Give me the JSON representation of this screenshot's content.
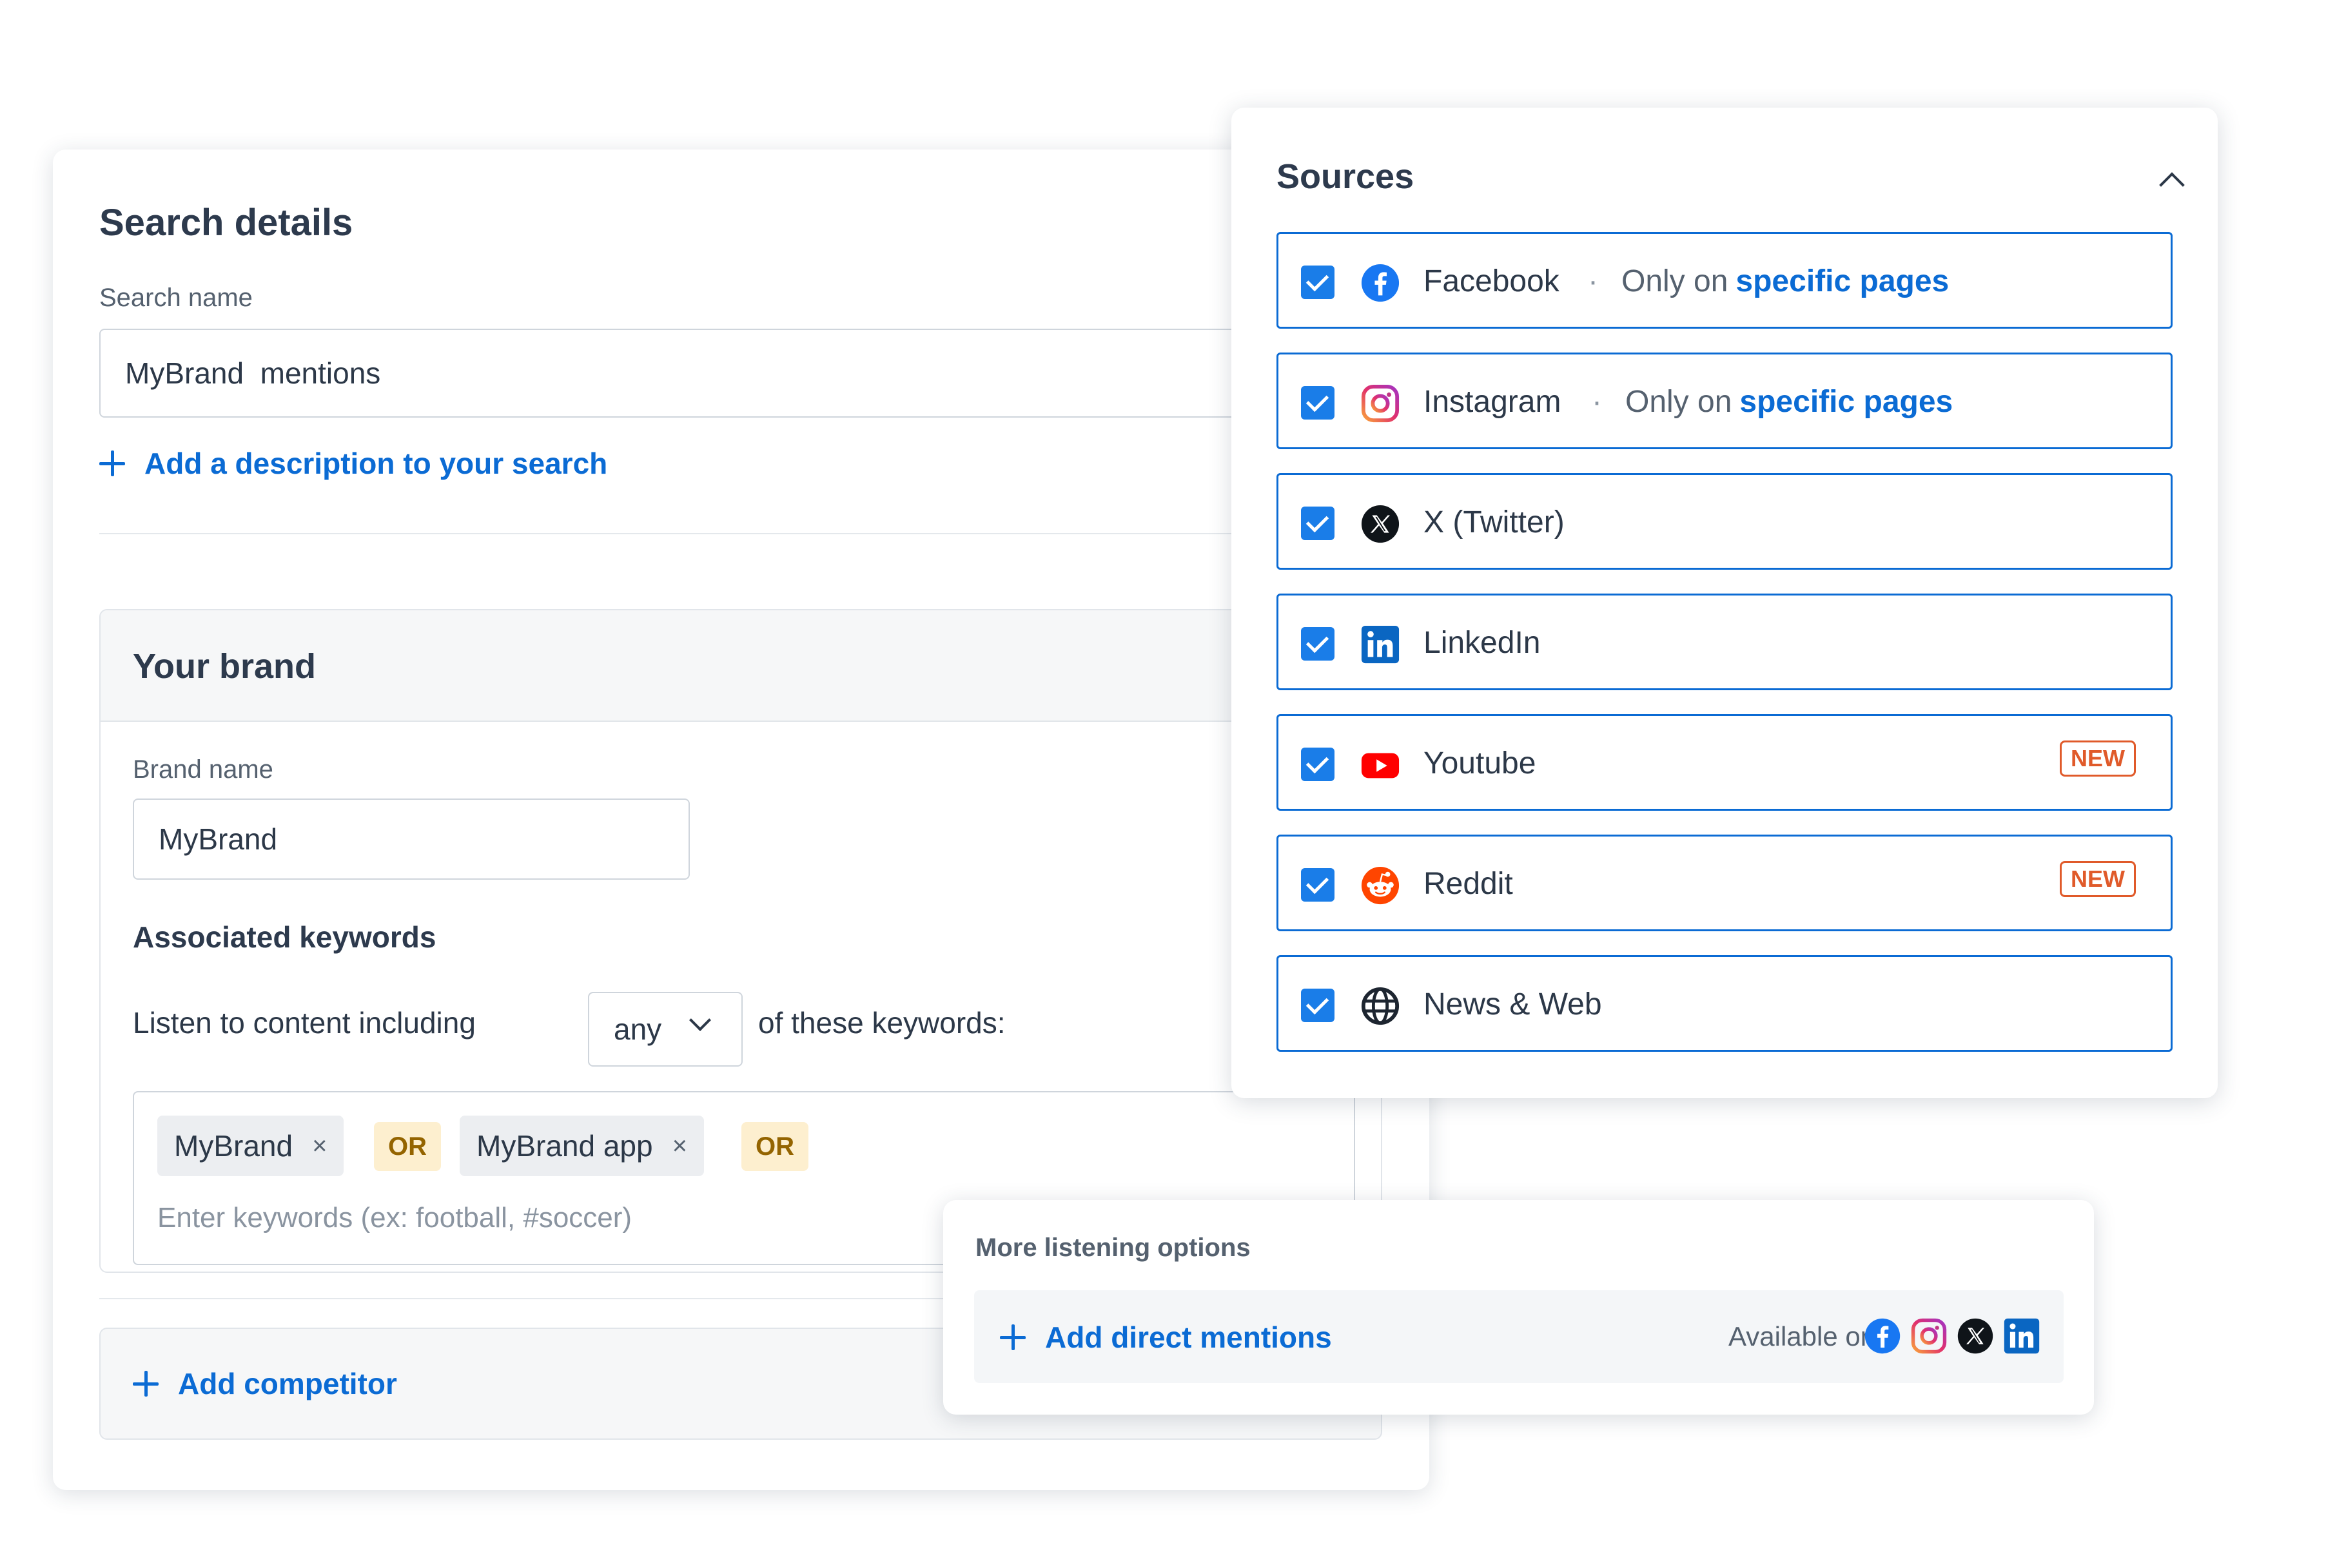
{
  "search_details": {
    "title": "Search details",
    "search_name_label": "Search name",
    "search_name_value": "MyBrand  mentions",
    "add_description": "Add a description to your search",
    "brand": {
      "section_title": "Your brand",
      "brand_name_label": "Brand name",
      "brand_name_value": "MyBrand",
      "keywords_label": "Associated keywords",
      "listen_prefix": "Listen to content including",
      "match_mode": "any",
      "listen_suffix": "of these keywords:",
      "keywords": [
        "MyBrand",
        "MyBrand app"
      ],
      "remove_symbol": "×",
      "operator": "OR",
      "keyword_placeholder": "Enter keywords (ex: football, #soccer)"
    },
    "add_competitor": "Add competitor"
  },
  "sources": {
    "title": "Sources",
    "items": [
      {
        "name": "Facebook",
        "checked": true,
        "icon": "facebook-icon",
        "qualifier_separator": "·",
        "qualifier_prefix": "Only on",
        "qualifier_link": "specific pages"
      },
      {
        "name": "Instagram",
        "checked": true,
        "icon": "instagram-icon",
        "qualifier_separator": "·",
        "qualifier_prefix": "Only on",
        "qualifier_link": "specific pages"
      },
      {
        "name": "X (Twitter)",
        "checked": true,
        "icon": "x-twitter-icon"
      },
      {
        "name": "LinkedIn",
        "checked": true,
        "icon": "linkedin-icon"
      },
      {
        "name": "Youtube",
        "checked": true,
        "icon": "youtube-icon",
        "badge": "NEW"
      },
      {
        "name": "Reddit",
        "checked": true,
        "icon": "reddit-icon",
        "badge": "NEW"
      },
      {
        "name": "News & Web",
        "checked": true,
        "icon": "globe-icon"
      }
    ]
  },
  "more_options": {
    "title": "More listening options",
    "add_direct_mentions": "Add direct mentions",
    "available_on": "Available on",
    "available_icons": [
      "facebook-icon",
      "instagram-icon",
      "x-twitter-icon",
      "linkedin-icon"
    ]
  },
  "colors": {
    "accent": "#0b6bd4",
    "checkbox": "#1a7de8",
    "new_badge": "#e05a2a",
    "or_tag_bg": "#fdefcf",
    "or_tag_text": "#946400"
  }
}
